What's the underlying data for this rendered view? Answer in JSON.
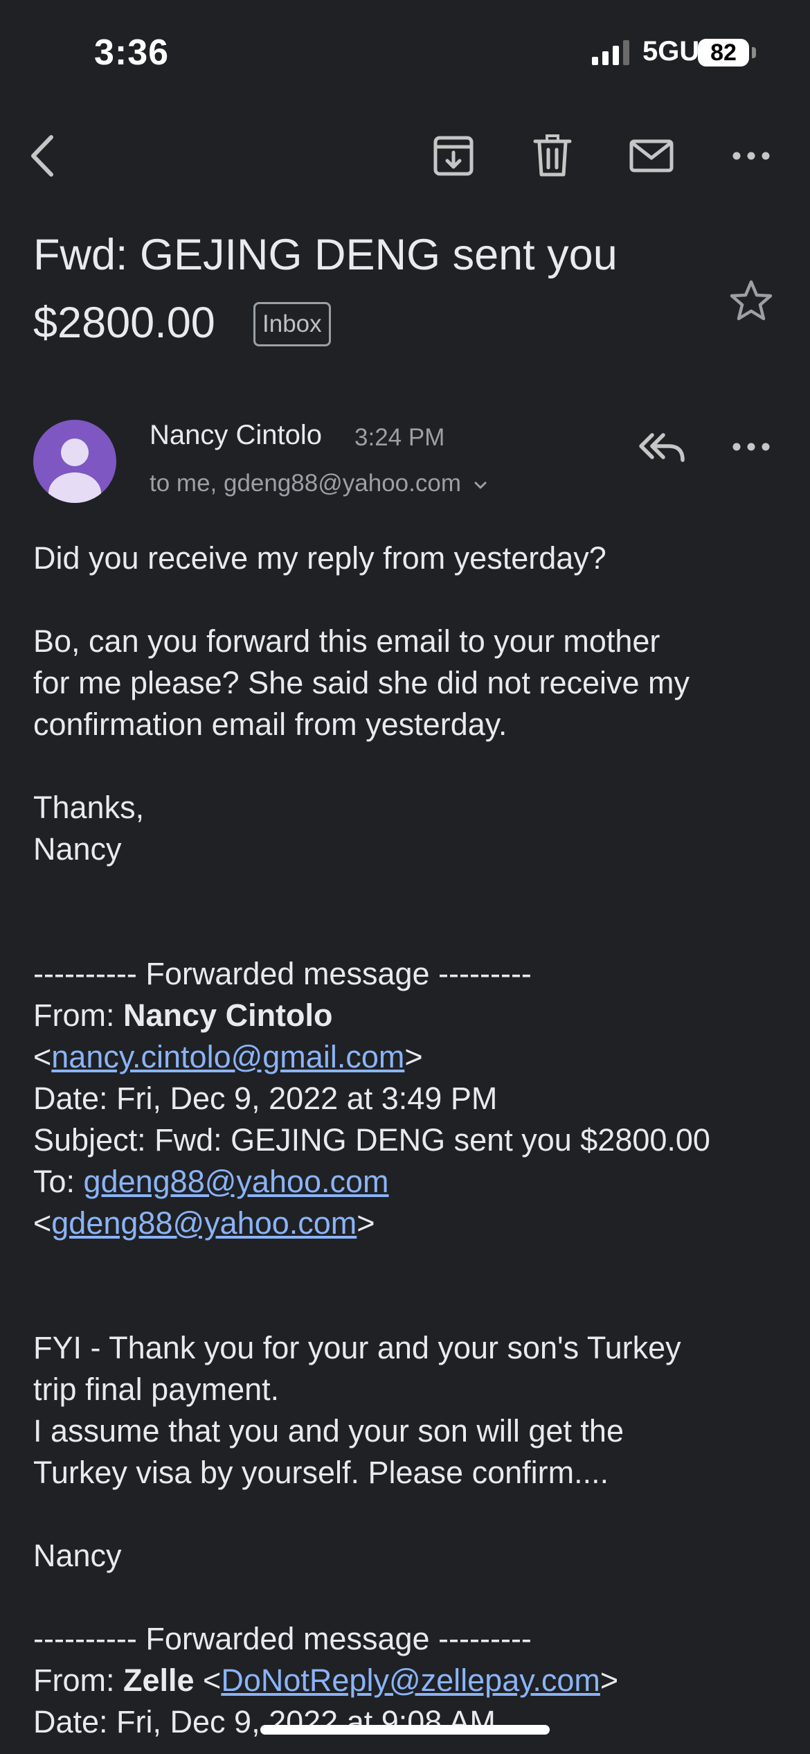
{
  "status_bar": {
    "time": "3:36",
    "network": "5GUC",
    "battery": "82"
  },
  "toolbar": {
    "icons": [
      "back-arrow-icon",
      "archive-icon",
      "trash-icon",
      "mail-icon",
      "more-icon"
    ]
  },
  "subject": {
    "line1": "Fwd: GEJING DENG sent you",
    "line2": "$2800.00",
    "label": "Inbox"
  },
  "message": {
    "sender": "Nancy Cintolo",
    "time": "3:24 PM",
    "recipients": "to me, gdeng88@yahoo.com"
  },
  "body": {
    "l1": "Did you receive my reply from yesterday?",
    "l2": "Bo, can you forward this email to your mother",
    "l3": "for me please? She said she did not receive my",
    "l4": "confirmation email from yesterday.",
    "l5": "Thanks,",
    "l6": "Nancy",
    "fwd1_header": "---------- Forwarded message ---------",
    "fwd1_from_label": "From: ",
    "fwd1_from_name": "Nancy Cintolo",
    "fwd1_from_email": "nancy.cintolo@gmail.com",
    "fwd1_date": "Date: Fri, Dec 9, 2022 at 3:49 PM",
    "fwd1_subject": "Subject: Fwd: GEJING DENG sent you $2800.00",
    "fwd1_to_label": "To: ",
    "fwd1_to_email": "gdeng88@yahoo.com",
    "fwd1_to_email2": "gdeng88@yahoo.com",
    "l7": "FYI - Thank you for your and your son's Turkey",
    "l8": "trip final payment.",
    "l9": "I assume that you and your son will get the",
    "l10": "Turkey visa by yourself. Please confirm....",
    "l11": "Nancy",
    "fwd2_header": "---------- Forwarded message ---------",
    "fwd2_from_label": "From: ",
    "fwd2_from_name": "Zelle",
    "fwd2_from_email": "DoNotReply@zellepay.com",
    "fwd2_date": "Date: Fri, Dec 9, 2022 at 9:08 AM"
  },
  "colors": {
    "background": "#202124",
    "text": "#e8eaed",
    "secondary": "#9aa0a6",
    "link": "#8ab4f8",
    "avatar": "#7e57c2"
  }
}
